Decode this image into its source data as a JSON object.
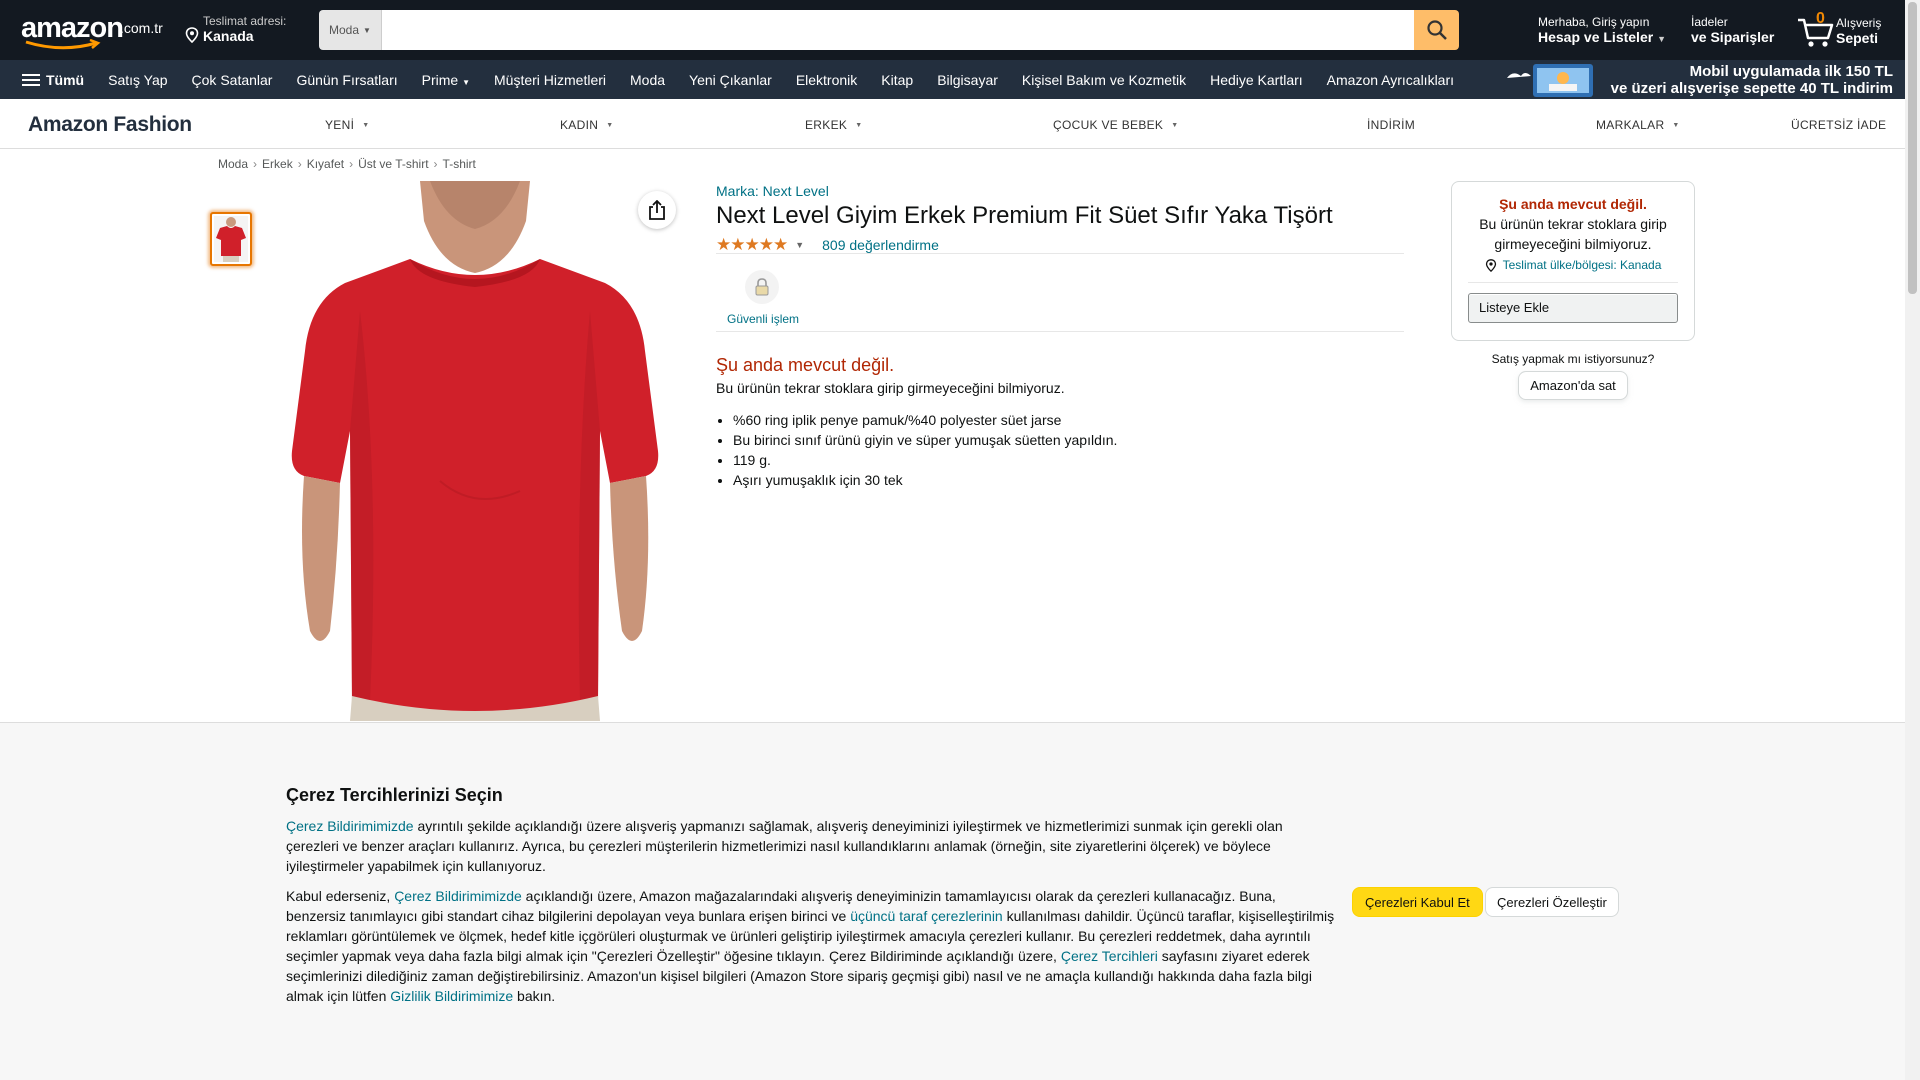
{
  "header": {
    "logo_text": "amazon",
    "logo_tld": ".com.tr",
    "deliver_label": "Teslimat adresi:",
    "deliver_location": "Kanada",
    "search_category": "Moda",
    "search_value": "",
    "account_line1": "Merhaba, Giriş yapın",
    "account_line2": "Hesap ve Listeler",
    "orders_line1": "İadeler",
    "orders_line2": "ve Siparişler",
    "cart_count": "0",
    "cart_line1": "Alışveriş",
    "cart_line2": "Sepeti"
  },
  "subnav": {
    "all_label": "Tümü",
    "items": [
      "Satış Yap",
      "Çok Satanlar",
      "Günün Fırsatları",
      "Prime",
      "Müşteri Hizmetleri",
      "Moda",
      "Yeni Çıkanlar",
      "Elektronik",
      "Kitap",
      "Bilgisayar",
      "Kişisel Bakım ve Kozmetik",
      "Hediye Kartları",
      "Amazon Ayrıcalıkları"
    ],
    "promo_line1": "Mobil uygulamada ilk 150 TL",
    "promo_line2": "ve üzeri alışverişe sepette 40 TL indirim"
  },
  "fashion_bar": {
    "brand": "Amazon Fashion",
    "categories": [
      "YENİ",
      "KADIN",
      "ERKEK",
      "ÇOCUK VE BEBEK",
      "İNDİRİM",
      "MARKALAR",
      "ÜCRETSİZ İADE"
    ]
  },
  "breadcrumb": [
    "Moda",
    "Erkek",
    "Kıyafet",
    "Üst ve T-shirt",
    "T-shirt"
  ],
  "product": {
    "brand_link": "Marka: Next Level",
    "title": "Next Level Giyim Erkek Premium Fit Süet Sıfır Yaka Tişört",
    "rating": 4.5,
    "rating_stars": "★★★★★",
    "review_count": "809 değerlendirme",
    "secure_label": "Güvenli işlem",
    "unavailable_title": "Şu anda mevcut değil.",
    "unavailable_text": "Bu ürünün tekrar stoklara girip girmeyeceğini bilmiyoruz.",
    "bullets": [
      "%60 ring iplik penye pamuk/%40 polyester süet jarse",
      "Bu birinci sınıf ürünü giyin ve süper yumuşak süetten yapıldın.",
      "119 g.",
      "Aşırı yumuşaklık için 30 tek"
    ],
    "shirt_color": "#d0202a"
  },
  "buybox": {
    "status": "Şu anda mevcut değil.",
    "message": "Bu ürünün tekrar stoklara girip girmeyeceğini bilmiyoruz.",
    "location": "Teslimat ülke/bölgesi: Kanada",
    "add_to_list": "Listeye Ekle",
    "sell_question": "Satış yapmak mı istiyorsunuz?",
    "sell_button": "Amazon'da sat"
  },
  "cookie": {
    "title": "Çerez Tercihlerinizi Seçin",
    "p1_link": "Çerez Bildirimimizde",
    "p1_text": " ayrıntılı şekilde açıklandığı üzere alışveriş yapmanızı sağlamak, alışveriş deneyiminizi iyileştirmek ve hizmetlerimizi sunmak için gerekli olan çerezleri ve benzer araçları kullanırız. Ayrıca, bu çerezleri müşterilerin hizmetlerimizi nasıl kullandıklarını anlamak (örneğin, site ziyaretlerini ölçerek) ve böylece iyileştirmeler yapabilmek için kullanıyoruz.",
    "p2_a": "Kabul ederseniz, ",
    "p2_link1": "Çerez Bildirimimizde",
    "p2_b": " açıklandığı üzere, Amazon mağazalarındaki alışveriş deneyiminizin tamamlayıcısı olarak da çerezleri kullanacağız. Buna, benzersiz tanımlayıcı gibi standart cihaz bilgilerini depolayan veya bunlara erişen birinci ve ",
    "p2_link2": "üçüncü taraf çerezlerinin",
    "p2_c": " kullanılması dahildir. Üçüncü taraflar, kişiselleştirilmiş reklamları görüntülemek ve ölçmek, hedef kitle içgörüleri oluşturmak ve ürünleri geliştirip iyileştirmek amacıyla çerezleri kullanır. Bu çerezleri reddetmek, daha ayrıntılı seçimler yapmak veya daha fazla bilgi almak için \"Çerezleri Özelleştir\" öğesine tıklayın. Çerez Bildiriminde açıklandığı üzere, ",
    "p2_link3": "Çerez Tercihleri",
    "p2_d": " sayfasını ziyaret ederek seçimlerinizi dilediğiniz zaman değiştirebilirsiniz. Amazon'un kişisel bilgileri (Amazon Store sipariş geçmişi gibi) nasıl ve ne amaçla kullandığı hakkında daha fazla bilgi almak için lütfen ",
    "p2_link4": "Gizlilik Bildirimimize",
    "p2_e": " bakın.",
    "accept_button": "Çerezleri Kabul Et",
    "customize_button": "Çerezleri Özelleştir"
  },
  "colors": {
    "nav_dark": "#131921",
    "nav_sub": "#232f3e",
    "search_button": "#febd69",
    "accent_orange": "#f08804",
    "link": "#007185",
    "unavailable_red": "#b12704",
    "accept_yellow": "#ffd814"
  }
}
